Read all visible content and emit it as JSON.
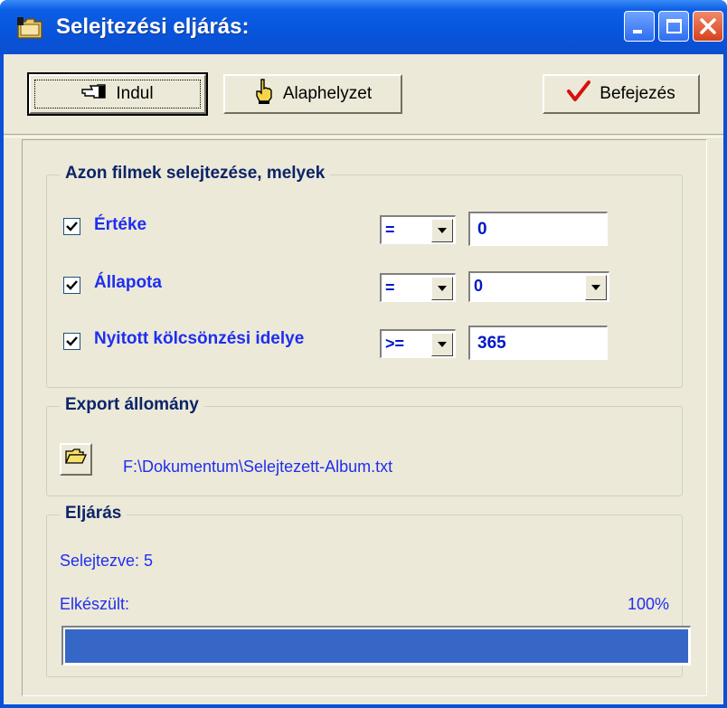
{
  "window": {
    "title": "Selejtezési eljárás:",
    "icon": "folder-app-icon"
  },
  "toolbar": {
    "start_label": "Indul",
    "reset_label": "Alaphelyzet",
    "finish_label": "Befejezés"
  },
  "criteria": {
    "title": "Azon filmek selejtezése, melyek",
    "rows": [
      {
        "label": "Értéke",
        "checked": true,
        "operator": "=",
        "value": "0"
      },
      {
        "label": "Állapota",
        "checked": true,
        "operator": "=",
        "value": "0"
      },
      {
        "label": "Nyitott kölcsönzési idelye",
        "checked": true,
        "operator": ">=",
        "value": "365"
      }
    ]
  },
  "export": {
    "title": "Export állomány",
    "path": "F:\\Dokumentum\\Selejtezett-Album.txt"
  },
  "procedure": {
    "title": "Eljárás",
    "discarded_text": "Selejtezve: 5",
    "done_label": "Elkészült:",
    "percent_text": "100%",
    "progress_fraction": 1.0
  },
  "colors": {
    "accent": "#1f2ef0",
    "progress": "#3767c6",
    "titlebar": "#0854dc"
  }
}
